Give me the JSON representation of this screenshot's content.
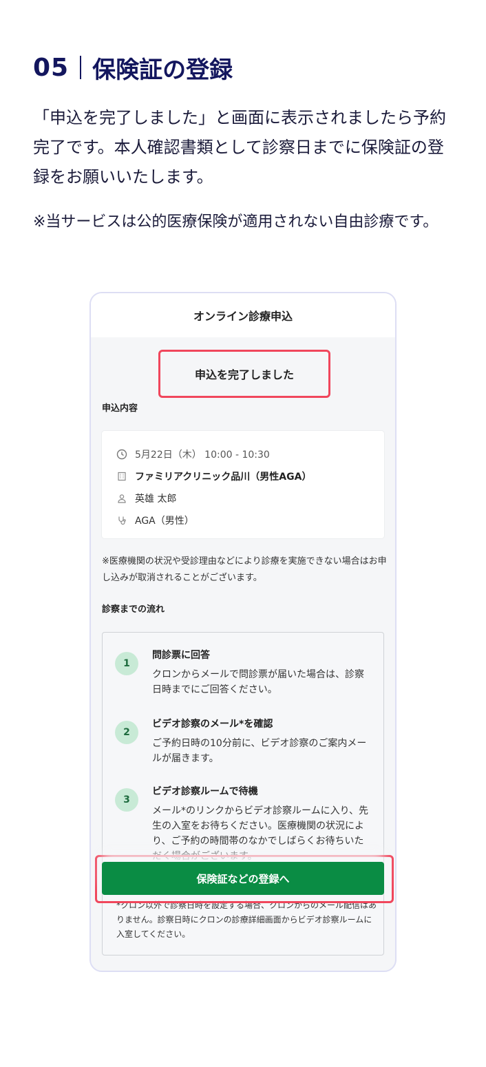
{
  "heading": {
    "number": "05",
    "title": "保険証の登録"
  },
  "lead": "「申込を完了しました」と画面に表示されましたら予約完了です。本人確認書類として診察日までに保険証の登録をお願いいたします。",
  "note": "※当サービスは公的医療保険が適用されない自由診療です。",
  "phone": {
    "header_title": "オンライン診療申込",
    "complete_message": "申込を完了しました",
    "details_label": "申込内容",
    "details": {
      "datetime": "5月22日（木） 10:00 - 10:30",
      "clinic": "ファミリアクリニック品川（男性AGA）",
      "patient": "英雄 太郎",
      "menu": "AGA（男性）"
    },
    "warning": "※医療機関の状況や受診理由などにより診療を実施できない場合はお申し込みが取消されることがございます。",
    "flow_label": "診察までの流れ",
    "steps": [
      {
        "num": "1",
        "title": "問診票に回答",
        "text": "クロンからメールで問診票が届いた場合は、診察日時までにご回答ください。"
      },
      {
        "num": "2",
        "title": "ビデオ診察のメール*を確認",
        "text": "ご予約日時の10分前に、ビデオ診察のご案内メールが届きます。"
      },
      {
        "num": "3",
        "title": "ビデオ診察ルームで待機",
        "text": "メール*のリンクからビデオ診察ルームに入り、先生の入室をお待ちください。医療機関の状況により、ご予約の時間帯のなかでしばらくお待ちいただく場合がございます。"
      }
    ],
    "footnote": "*クロン以外で診察日時を設定する場合、クロンからのメール配信はありません。診察日時にクロンの診療詳細画面からビデオ診察ルームに入室してください。",
    "cta_label": "保険証などの登録へ"
  },
  "icons": {
    "datetime": "clock-icon",
    "clinic": "building-icon",
    "patient": "person-icon",
    "menu": "stethoscope-icon"
  },
  "colors": {
    "heading": "#13165e",
    "highlight": "#f0465c",
    "cta": "#0a8c44",
    "badge": "#c8ead6"
  }
}
